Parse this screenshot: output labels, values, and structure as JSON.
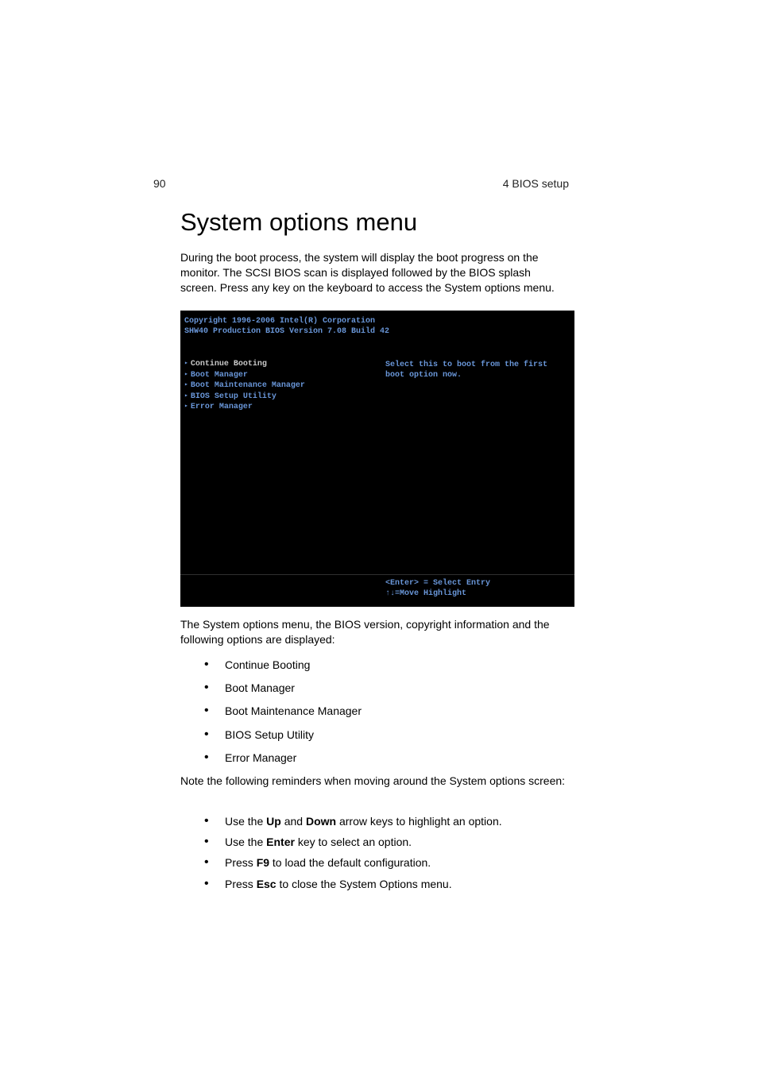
{
  "header": {
    "page_number": "90",
    "section": "4 BIOS setup"
  },
  "title": "System options menu",
  "intro": "During the boot process, the system will display the boot progress on the monitor. The SCSI BIOS scan is displayed followed by the BIOS splash screen. Press any key on the keyboard to access the System options menu.",
  "bios": {
    "copyright_line1": "Copyright 1996-2006 Intel(R) Corporation",
    "copyright_line2": "SHW40 Production BIOS Version 7.08 Build 42",
    "menu_items": [
      "Continue Booting",
      "Boot Manager",
      "Boot Maintenance Manager",
      "BIOS Setup Utility",
      "Error Manager"
    ],
    "help_text": "Select this to boot from the first boot option now.",
    "footer_line1": "<Enter> = Select Entry",
    "footer_line2": "↑↓=Move Highlight"
  },
  "description": "The System options menu, the BIOS version, copyright information and the following options are displayed:",
  "options": [
    "Continue Booting",
    "Boot Manager",
    "Boot Maintenance Manager",
    "BIOS Setup Utility",
    "Error Manager"
  ],
  "reminder_intro": "Note the following reminders when moving around the System options screen:",
  "reminders": {
    "r1_pre": "Use the ",
    "r1_key1": "Up",
    "r1_mid": " and ",
    "r1_key2": "Down",
    "r1_post": " arrow keys to highlight an option.",
    "r2_pre": "Use the ",
    "r2_key": "Enter",
    "r2_post": " key to select an option.",
    "r3_pre": "Press ",
    "r3_key": "F9",
    "r3_post": " to load the default configuration.",
    "r4_pre": "Press ",
    "r4_key": "Esc",
    "r4_post": " to close the System Options menu."
  }
}
